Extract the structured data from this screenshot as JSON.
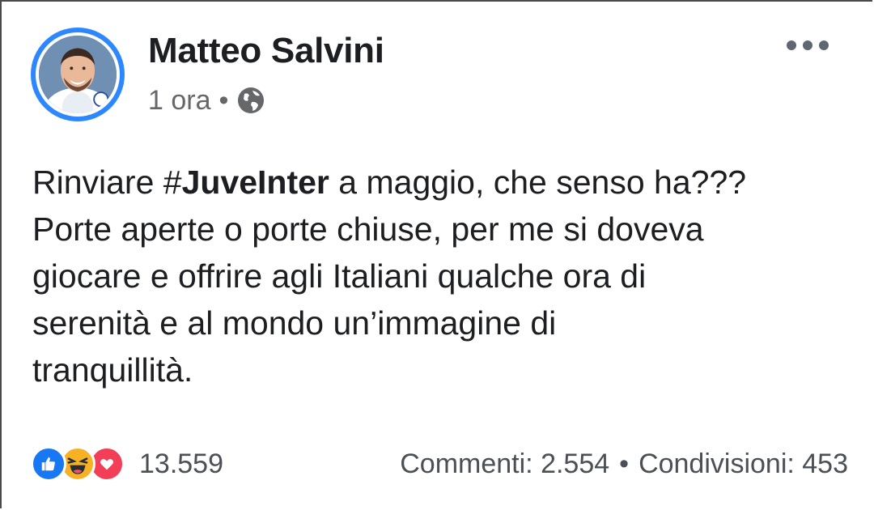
{
  "post": {
    "author": "Matteo Salvini",
    "time": "1 ora",
    "separator": "•",
    "text_lines": {
      "l1_prefix": "Rinviare #",
      "l1_hashtag": "JuveInter",
      "l1_suffix": " a maggio, che senso ha???",
      "l2": "Porte aperte o porte chiuse, per me si doveva",
      "l3": "giocare e offrire agli Italiani qualche ora di",
      "l4": "serenità e al mondo un’immagine di",
      "l5": "tranquillità."
    }
  },
  "engagement": {
    "reactions_count": "13.559",
    "comments": "Commenti: 2.554",
    "separator": "•",
    "shares": "Condivisioni: 453"
  },
  "icons": {
    "privacy": "globe-icon",
    "menu": "more-horizontal-icon",
    "reactions": [
      "like-icon",
      "haha-icon",
      "love-icon"
    ]
  },
  "colors": {
    "accent": "#1877f2",
    "avatar_ring": "#2d88ff",
    "like": "#1877f2",
    "haha": "#f7b125",
    "love": "#f33e58",
    "secondary_text": "#65676b"
  }
}
